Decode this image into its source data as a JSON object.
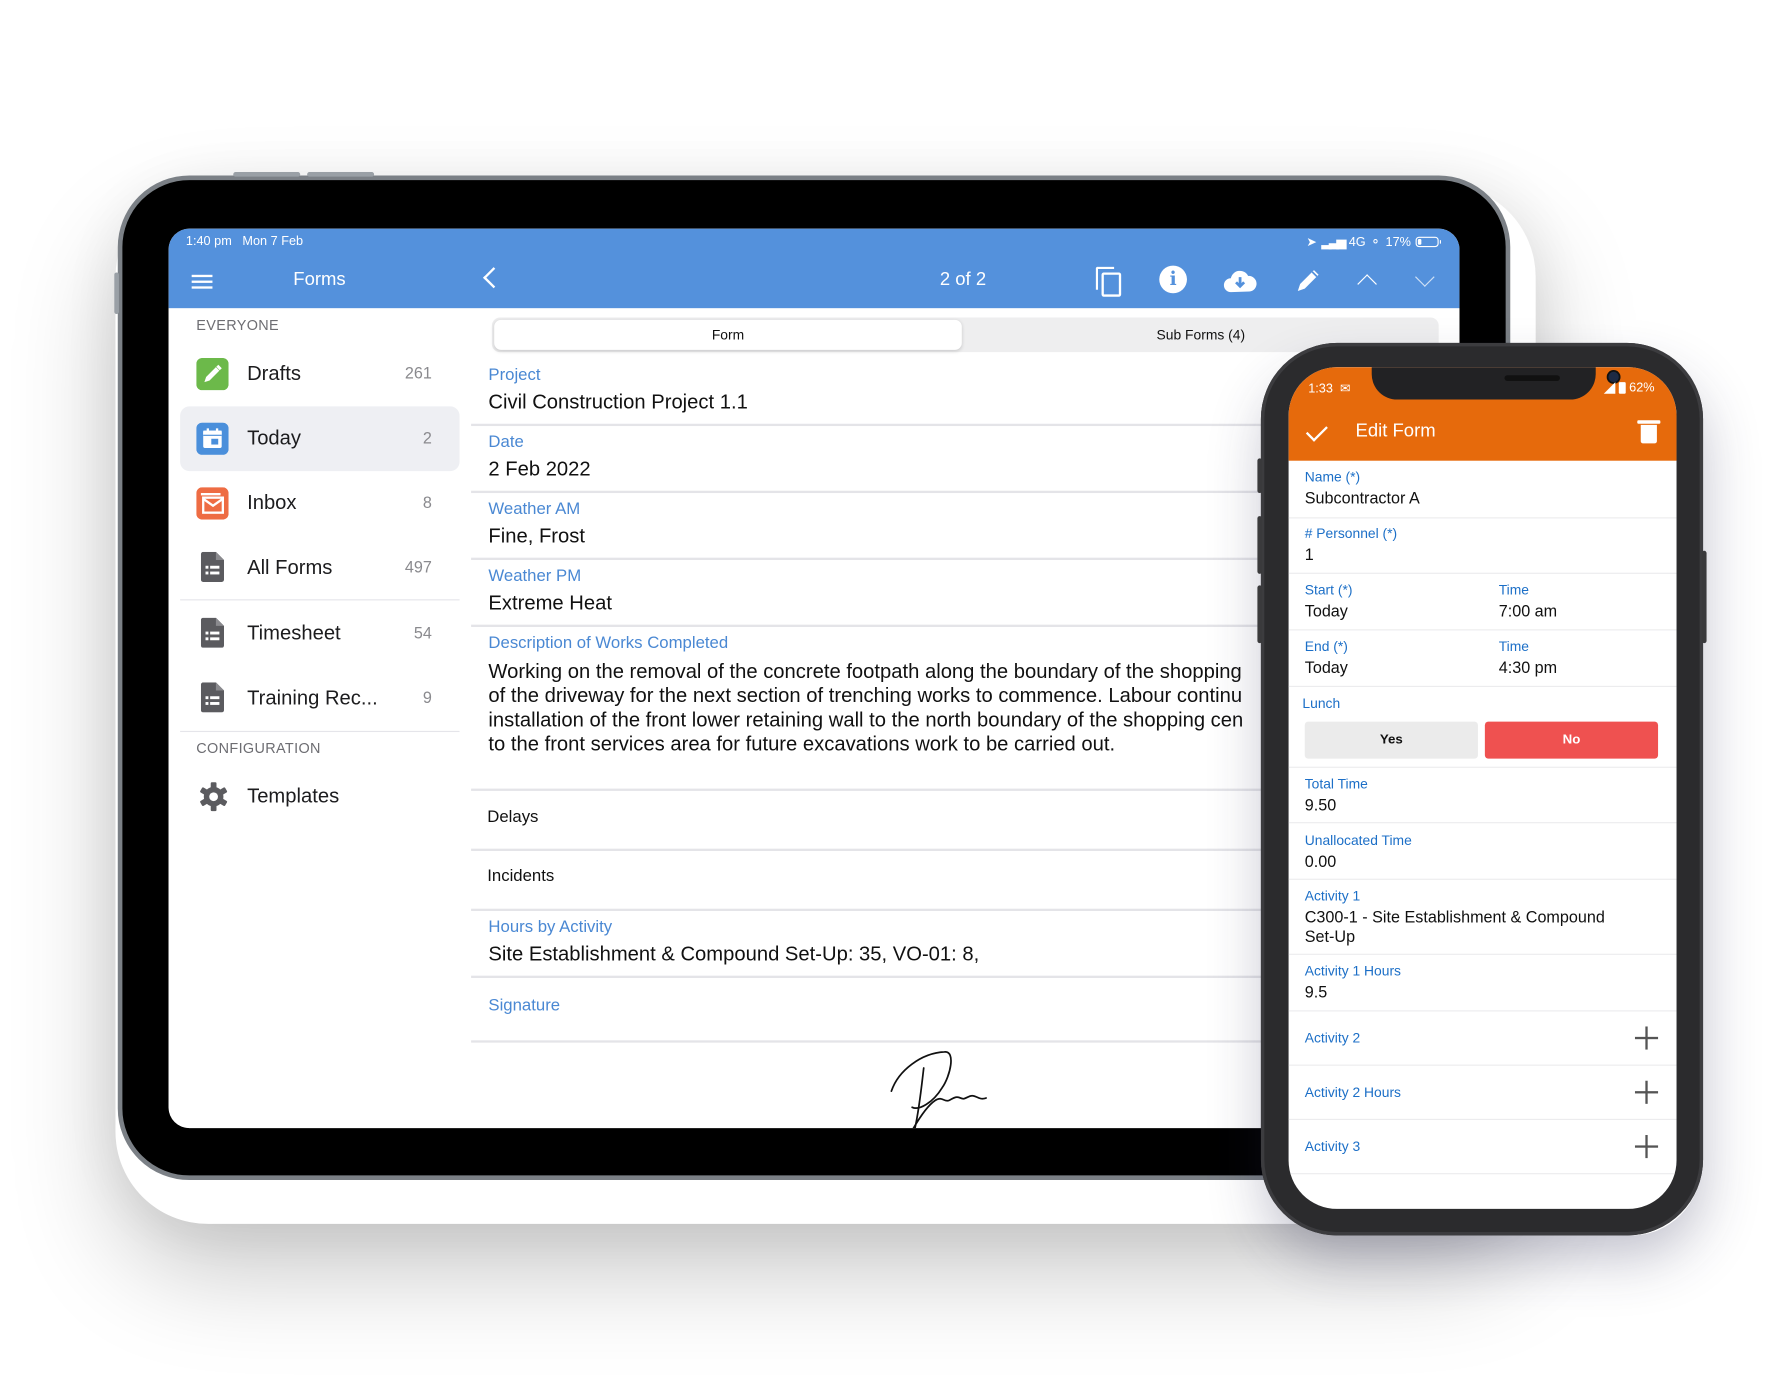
{
  "tablet": {
    "status_bar": {
      "time": "1:40 pm",
      "date": "Mon 7 Feb",
      "network": "4G",
      "battery": "17%"
    },
    "sidebar_title": "Forms",
    "pager": "2 of 2",
    "toolbar_icons": [
      "copy-icon",
      "info-icon",
      "cloud-download-icon",
      "pencil-icon",
      "chevron-up-icon",
      "chevron-down-icon"
    ],
    "sidebar": {
      "section_everyone": "EVERYONE",
      "section_configuration": "CONFIGURATION",
      "items": [
        {
          "label": "Drafts",
          "count": "261",
          "icon": "pencil-icon",
          "color": "#6cb94a"
        },
        {
          "label": "Today",
          "count": "2",
          "icon": "calendar-icon",
          "color": "#4a8fdb",
          "active": true
        },
        {
          "label": "Inbox",
          "count": "8",
          "icon": "mail-icon",
          "color": "#ee6c43"
        },
        {
          "label": "All Forms",
          "count": "497",
          "icon": "document-icon"
        },
        {
          "label": "Timesheet",
          "count": "54",
          "icon": "document-icon"
        },
        {
          "label": "Training Rec...",
          "count": "9",
          "icon": "document-icon"
        }
      ],
      "config_items": [
        {
          "label": "Templates",
          "icon": "gear-icon"
        }
      ]
    },
    "tabs": [
      {
        "label": "Form",
        "active": true
      },
      {
        "label": "Sub Forms (4)",
        "active": false
      }
    ],
    "fields": {
      "project": {
        "label": "Project",
        "value": "Civil Construction Project 1.1"
      },
      "date": {
        "label": "Date",
        "value": "2 Feb 2022"
      },
      "weather_am": {
        "label": "Weather AM",
        "value": "Fine, Frost"
      },
      "weather_pm": {
        "label": "Weather PM",
        "value": "Extreme Heat"
      },
      "description": {
        "label": "Description of Works Completed",
        "lines": [
          "Working on the removal of the concrete footpath along the boundary of the shopping",
          "of the driveway for the next section of trenching works to commence. Labour continu",
          "installation of the front lower retaining wall to the north boundary of the shopping cen",
          "to the front services area for future excavations work to be carried out."
        ]
      },
      "delays": {
        "label": "Delays"
      },
      "incidents": {
        "label": "Incidents"
      },
      "hours_by_activity": {
        "label": "Hours by Activity",
        "value": "Site Establishment & Compound Set-Up: 35, VO-01: 8,"
      },
      "signature": {
        "label": "Signature"
      }
    }
  },
  "phone": {
    "status_bar": {
      "time": "1:33",
      "battery": "62%"
    },
    "title": "Edit Form",
    "fields": {
      "name": {
        "label": "Name (*)",
        "value": "Subcontractor A"
      },
      "personnel": {
        "label": "# Personnel (*)",
        "value": "1"
      },
      "start": {
        "label": "Start (*)",
        "value": "Today",
        "time_label": "Time",
        "time_value": "7:00 am"
      },
      "end": {
        "label": "End (*)",
        "value": "Today",
        "time_label": "Time",
        "time_value": "4:30 pm"
      },
      "lunch": {
        "label": "Lunch",
        "yes": "Yes",
        "no": "No",
        "selected": "No"
      },
      "total_time": {
        "label": "Total Time",
        "value": "9.50"
      },
      "unallocated_time": {
        "label": "Unallocated Time",
        "value": "0.00"
      },
      "activity_1": {
        "label": "Activity 1",
        "value_line1": "C300-1 - Site Establishment & Compound",
        "value_line2": "Set-Up"
      },
      "activity_1_hours": {
        "label": "Activity 1 Hours",
        "value": "9.5"
      },
      "activity_2": {
        "label": "Activity 2"
      },
      "activity_2_hours": {
        "label": "Activity 2 Hours"
      },
      "activity_3": {
        "label": "Activity 3"
      }
    },
    "colors": {
      "accent": "#e66a0c",
      "label": "#1c6fc7",
      "no_selected": "#ef5150"
    }
  },
  "colors": {
    "tablet_accent": "#5491dc",
    "field_label": "#4a88d3"
  }
}
